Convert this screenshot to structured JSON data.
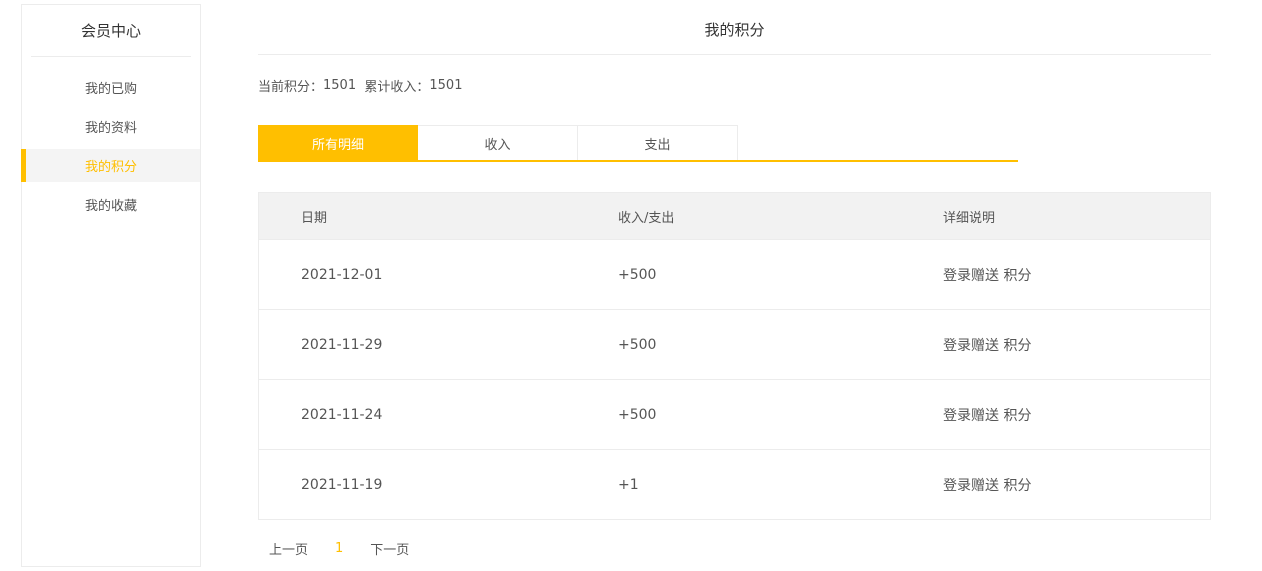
{
  "sidebar": {
    "title": "会员中心",
    "items": [
      {
        "label": "我的已购",
        "active": false
      },
      {
        "label": "我的资料",
        "active": false
      },
      {
        "label": "我的积分",
        "active": true
      },
      {
        "label": "我的收藏",
        "active": false
      }
    ]
  },
  "page_title": "我的积分",
  "summary": {
    "points_label": "当前积分：",
    "points_value": "1501",
    "income_label": "累计收入：",
    "income_value": "1501"
  },
  "tabs": [
    {
      "label": "所有明细",
      "active": true
    },
    {
      "label": "收入",
      "active": false
    },
    {
      "label": "支出",
      "active": false
    }
  ],
  "table": {
    "headers": [
      "日期",
      "收入/支出",
      "详细说明"
    ],
    "rows": [
      {
        "date": "2021-12-01",
        "amount": "+500",
        "desc": "登录赠送 积分"
      },
      {
        "date": "2021-11-29",
        "amount": "+500",
        "desc": "登录赠送 积分"
      },
      {
        "date": "2021-11-24",
        "amount": "+500",
        "desc": "登录赠送 积分"
      },
      {
        "date": "2021-11-19",
        "amount": "+1",
        "desc": "登录赠送 积分"
      }
    ]
  },
  "pagination": {
    "prev_label": "上一页",
    "current_page": "1",
    "next_label": "下一页"
  },
  "colors": {
    "accent": "#ffbf00",
    "header_bg": "#f2f2f2",
    "border": "#ececec"
  }
}
